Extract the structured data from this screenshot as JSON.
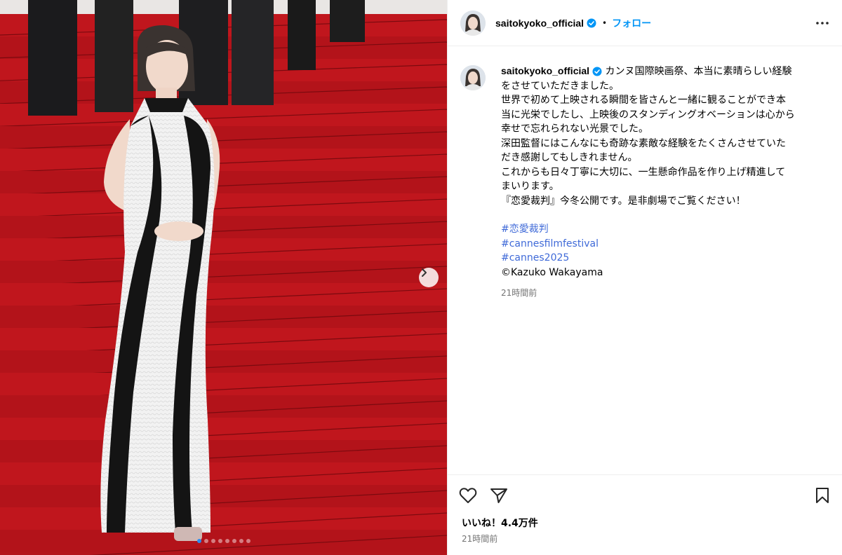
{
  "post": {
    "username": "saitokyoko_official",
    "separator": "•",
    "follow_label": "フォロー",
    "caption_lines": [
      "カンヌ国際映画祭、本当に素晴らしい経験",
      "をさせていただきました。",
      "世界で初めて上映される瞬間を皆さんと一緒に観ることができ本",
      "当に光栄でしたし、上映後のスタンディングオベーションは心から",
      "幸せで忘れられない光景でした。",
      "深田監督にはこんなにも奇跡な素敵な経験をたくさんさせていた",
      "だき感謝してもしきれません。",
      "これからも日々丁寧に大切に、一生懸命作品を作り上げ精進して",
      "まいります。",
      "『恋愛裁判』今冬公開です。是非劇場でご覧ください！"
    ],
    "hashtags": [
      "#恋愛裁判",
      "#cannesfilmfestival",
      "#cannes2025"
    ],
    "credit": "©Kazuko Wakayama",
    "caption_time": "21時間前",
    "likes": "いいね！4.4万件",
    "post_time": "21時間前"
  },
  "carousel": {
    "slide_count": 8,
    "active_index": 0
  },
  "icons": {
    "verified": "verified-badge-icon",
    "more": "more-options-icon",
    "next": "chevron-right-icon",
    "like": "heart-icon",
    "share": "paper-plane-icon",
    "save": "bookmark-icon"
  },
  "colors": {
    "accent": "#0095f6",
    "carpet": "#b4141b",
    "muted": "#737373"
  }
}
